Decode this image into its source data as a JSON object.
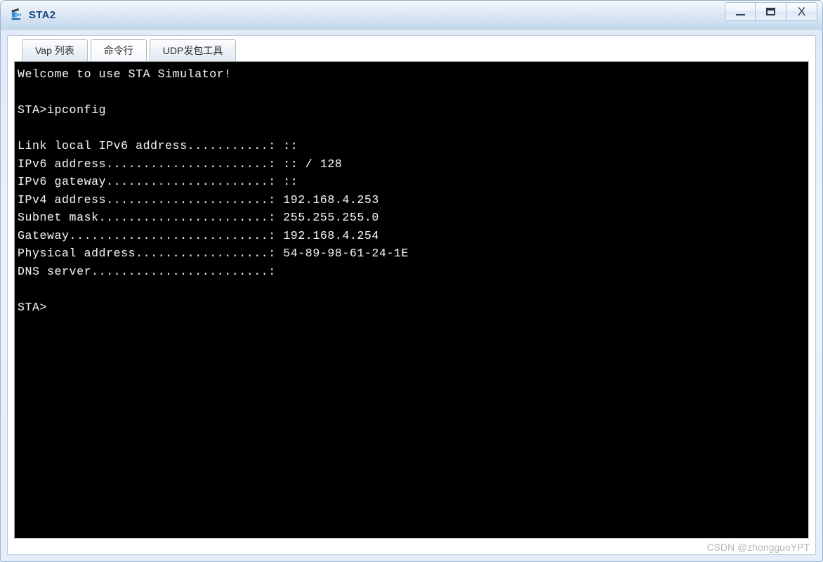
{
  "window": {
    "title": "STA2",
    "icon": "sta-device-icon",
    "controls": {
      "minimize": "–",
      "maximize": "▭",
      "close": "X",
      "minimize_name": "minimize-button",
      "maximize_name": "maximize-button",
      "close_name": "close-button"
    },
    "colors": {
      "titlebar_top": "#f2f6fc",
      "titlebar_bottom": "#c3d7ea",
      "frame": "#9ab4d0",
      "title_text": "#15447e",
      "terminal_bg": "#000000",
      "terminal_fg": "#f0f0f0"
    }
  },
  "tabs": [
    {
      "label": "Vap 列表",
      "name": "tab-vap-list",
      "active": false
    },
    {
      "label": "命令行",
      "name": "tab-command-line",
      "active": true
    },
    {
      "label": "UDP发包工具",
      "name": "tab-udp-packet-tool",
      "active": false
    }
  ],
  "terminal": {
    "lines": [
      "Welcome to use STA Simulator!",
      "",
      "STA>ipconfig",
      "",
      "Link local IPv6 address...........: ::",
      "IPv6 address......................: :: / 128",
      "IPv6 gateway......................: ::",
      "IPv4 address......................: 192.168.4.253",
      "Subnet mask.......................: 255.255.255.0",
      "Gateway...........................: 192.168.4.254",
      "Physical address..................: 54-89-98-61-24-1E",
      "DNS server........................:",
      "",
      "STA>"
    ],
    "banner": "Welcome to use STA Simulator!",
    "prompt": "STA>",
    "command": "ipconfig",
    "fields": [
      {
        "label": "Link local IPv6 address",
        "value": "::"
      },
      {
        "label": "IPv6 address",
        "value": ":: / 128"
      },
      {
        "label": "IPv6 gateway",
        "value": "::"
      },
      {
        "label": "IPv4 address",
        "value": "192.168.4.253"
      },
      {
        "label": "Subnet mask",
        "value": "255.255.255.0"
      },
      {
        "label": "Gateway",
        "value": "192.168.4.254"
      },
      {
        "label": "Physical address",
        "value": "54-89-98-61-24-1E"
      },
      {
        "label": "DNS server",
        "value": ""
      }
    ]
  },
  "watermark": {
    "text": "CSDN @zhongguoYPT"
  }
}
